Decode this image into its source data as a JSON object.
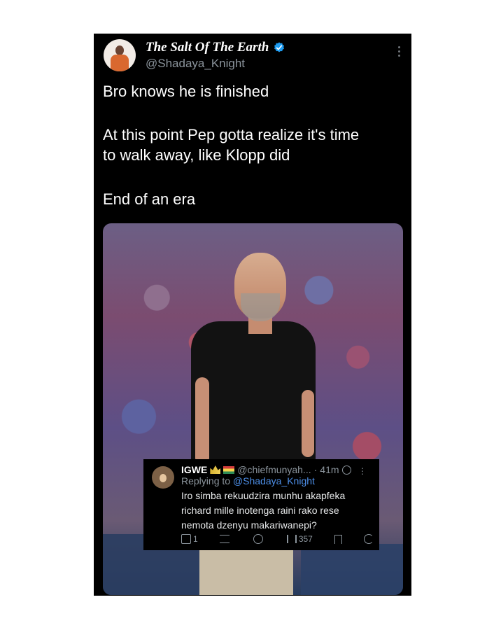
{
  "tweet": {
    "display_name": "The Salt Of The Earth",
    "handle": "@Shadaya_Knight",
    "text_lines": [
      "Bro knows he is finished",
      "At this point Pep gotta realize it's time",
      "to walk away, like Klopp did",
      "End of an era"
    ],
    "accent": "#1d9bf0",
    "icons": [
      "verified-badge-icon",
      "more-options-icon"
    ]
  },
  "reply": {
    "name": "IGWE",
    "handle": "@chiefmunyah...",
    "time": "41m",
    "replying_prefix": "Replying to",
    "replying_to": "@Shadaya_Knight",
    "text": "Iro simba rekuudzira munhu akapfeka richard mille inotenga raini rako rese nemota dzenyu makariwanepi?",
    "actions": {
      "replies": "1",
      "retweets": "",
      "likes": "",
      "views": "357"
    }
  }
}
